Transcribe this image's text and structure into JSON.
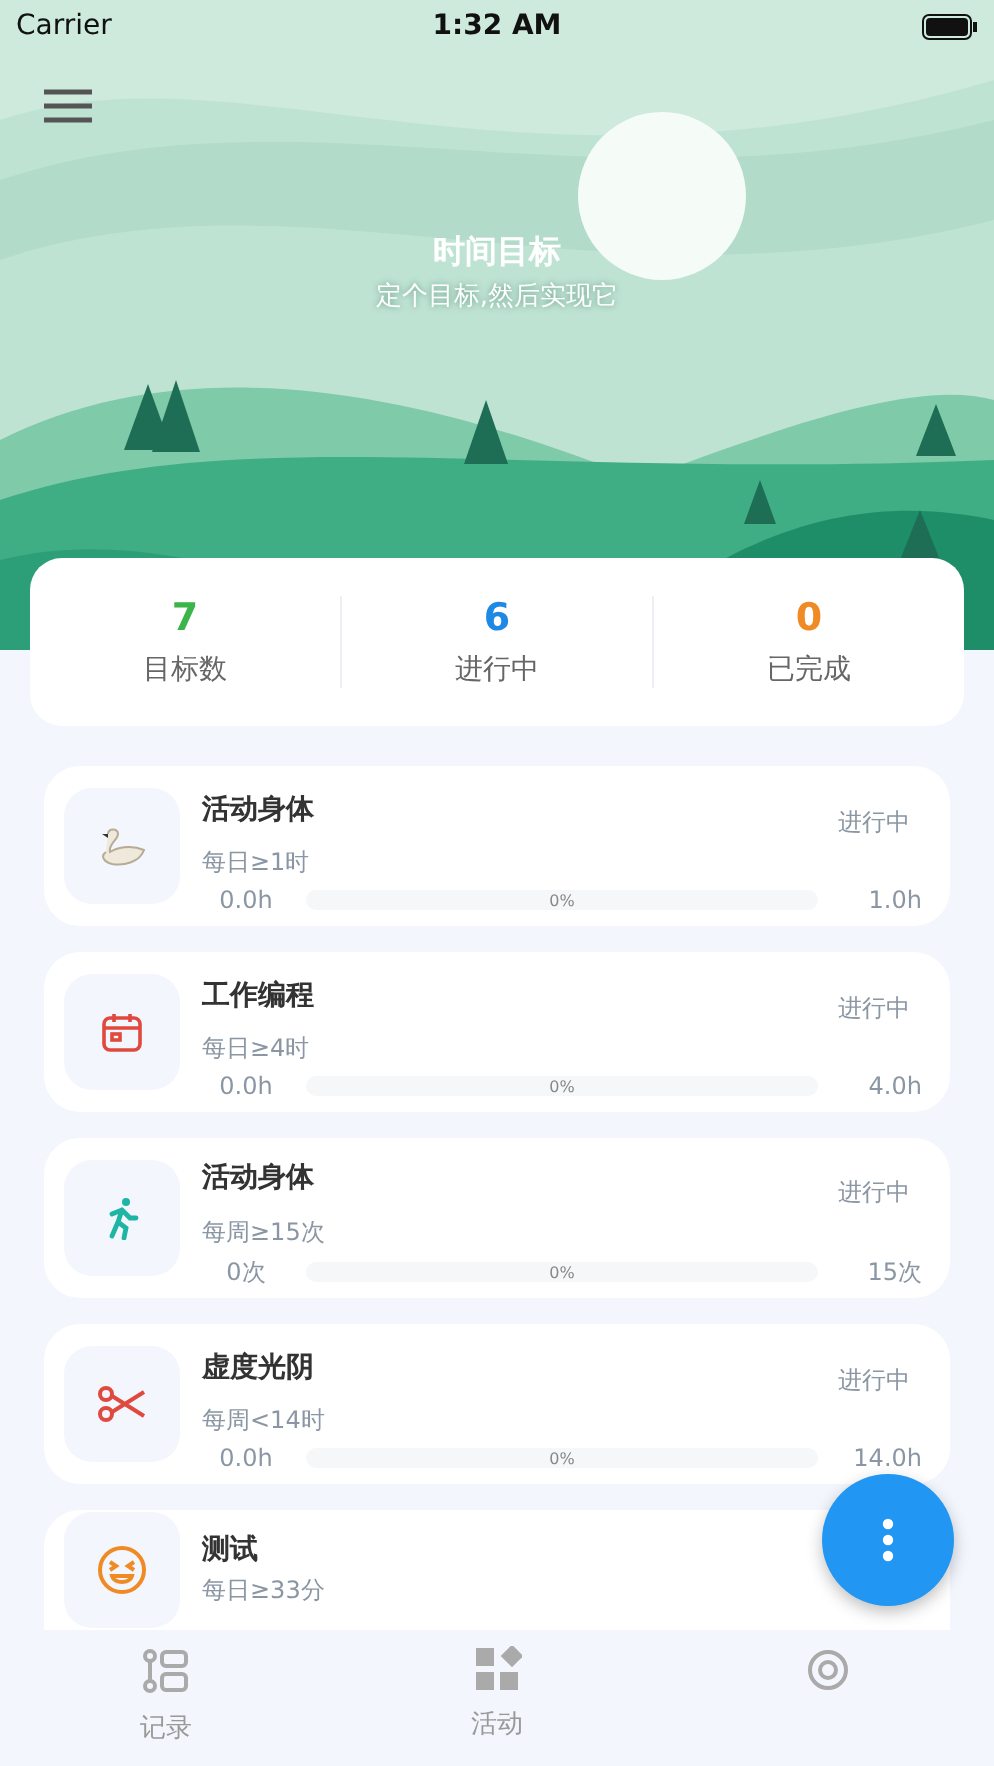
{
  "status_bar": {
    "carrier": "Carrier",
    "time": "1:32 AM"
  },
  "header": {
    "title": "时间目标",
    "subtitle": "定个目标,然后实现它"
  },
  "stats": [
    {
      "value": "7",
      "label": "目标数",
      "color": "#3bb54a"
    },
    {
      "value": "6",
      "label": "进行中",
      "color": "#1e88e5"
    },
    {
      "value": "0",
      "label": "已完成",
      "color": "#f08a24"
    }
  ],
  "goals": [
    {
      "kind": "swan",
      "title": "活动身体",
      "rule": "每日≥1时",
      "status": "进行中",
      "current": "0.0h",
      "percent": "0%",
      "target": "1.0h",
      "level": 0
    },
    {
      "kind": "calendar",
      "title": "工作编程",
      "rule": "每日≥4时",
      "status": "进行中",
      "current": "0.0h",
      "percent": "0%",
      "target": "4.0h",
      "level": 0
    },
    {
      "kind": "runner",
      "title": "活动身体",
      "rule": "每周≥15次",
      "status": "进行中",
      "current": "0次",
      "percent": "0%",
      "target": "15次",
      "level": 0
    },
    {
      "kind": "scissors",
      "title": "虚度光阴",
      "rule": "每周<14时",
      "status": "进行中",
      "current": "0.0h",
      "percent": "0%",
      "target": "14.0h",
      "level": 0
    },
    {
      "kind": "smile",
      "title": "测试",
      "rule": "每日≥33分"
    }
  ],
  "tabs": [
    {
      "kind": "record",
      "label": "记录",
      "selected": false
    },
    {
      "kind": "activity",
      "label": "活动",
      "selected": false
    },
    {
      "kind": "target",
      "selected": false
    }
  ]
}
